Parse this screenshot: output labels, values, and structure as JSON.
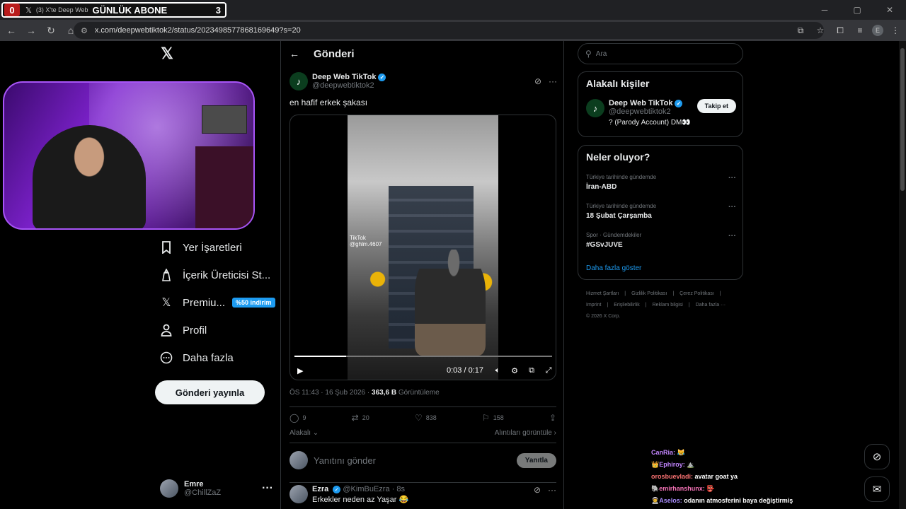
{
  "browser": {
    "stream_overlay": {
      "left_count": "0",
      "goal_label": "GÜNLÜK ABONE",
      "right_count": "3"
    },
    "tab_title": "(3) X'te Deep Web",
    "url": "x.com/deepwebtiktok2/status/2023498577868169649?s=20",
    "profile_initial": "E"
  },
  "sidebar": {
    "items": [
      {
        "label": "Yer İşaretleri",
        "icon": "bookmark-icon"
      },
      {
        "label": "İçerik Üreticisi St...",
        "icon": "creator-studio-icon"
      },
      {
        "label": "Premiu...",
        "icon": "x-logo-icon",
        "badge": "%50 indirim"
      },
      {
        "label": "Profil",
        "icon": "profile-icon"
      },
      {
        "label": "Daha fazla",
        "icon": "more-circle-icon"
      }
    ],
    "post_button": "Gönderi yayınla",
    "account": {
      "name": "Emre",
      "handle": "@ChillZaZ"
    }
  },
  "main": {
    "title": "Gönderi",
    "tweet": {
      "author_name": "Deep Web TikTok",
      "author_handle": "@deepwebtiktok2",
      "text": "en hafif erkek şakası",
      "video": {
        "time": "0:03 / 0:17",
        "progress": 0.2,
        "watermark_brand": "TikTok",
        "watermark_user": "@ghlm.4607"
      },
      "meta": {
        "timestamp": "ÖS 11:43 · 16 Şub 2026 · ",
        "views": "363,6 B",
        "views_label": " Görüntüleme"
      },
      "stats": {
        "replies": "9",
        "reposts": "20",
        "likes": "838",
        "bookmarks": "158"
      },
      "related_label": "Alakalı",
      "quotes_label": "Alıntıları görüntüle"
    },
    "reply_box": {
      "placeholder": "Yanıtını gönder",
      "button": "Yanıtla"
    },
    "comment": {
      "name": "Ezra",
      "handle": "@KimBuEzra · 8s",
      "text": "Erkekler neden az Yaşar 😂"
    }
  },
  "right": {
    "search_placeholder": "Ara",
    "related_people": {
      "title": "Alakalı kişiler",
      "name": "Deep Web TikTok",
      "handle": "@deepwebtiktok2",
      "bio": "? (Parody Account) DM👀",
      "follow": "Takip et"
    },
    "trends": {
      "title": "Neler oluyor?",
      "items": [
        {
          "context": "Türkiye tarihinde gündemde",
          "topic": "İran-ABD"
        },
        {
          "context": "Türkiye tarihinde gündemde",
          "topic": "18 Şubat Çarşamba"
        },
        {
          "context": "Spor · Gündemdekiler",
          "topic": "#GSvJUVE"
        }
      ],
      "show_more": "Daha fazla göster"
    },
    "footer": [
      "Hizmet Şartları",
      "|",
      "Gizlilik Politikası",
      "|",
      "Çerez Politikası",
      "|",
      "Imprint",
      "|",
      "Erişilebilirlik",
      "|",
      "Reklam bilgisi",
      "|",
      "Daha fazla ···",
      "© 2026 X Corp."
    ]
  },
  "chat": [
    {
      "user": "CanRia:",
      "msg": "😹"
    },
    {
      "user": "👑Ephiroy:",
      "msg": "⛰️"
    },
    {
      "user": "orosbuevladi:",
      "msg": "avatar goat ya"
    },
    {
      "user": "🐘emirhanshunx:",
      "msg": "👺"
    },
    {
      "user": "👨‍🚀Aselos:",
      "msg": "odanın atmosferini baya değiştirmiş"
    }
  ],
  "colors": {
    "accent": "#1d9bf0",
    "background": "#000000",
    "text": "#e7e9ea",
    "muted": "#71767b",
    "border": "#2f3336"
  }
}
